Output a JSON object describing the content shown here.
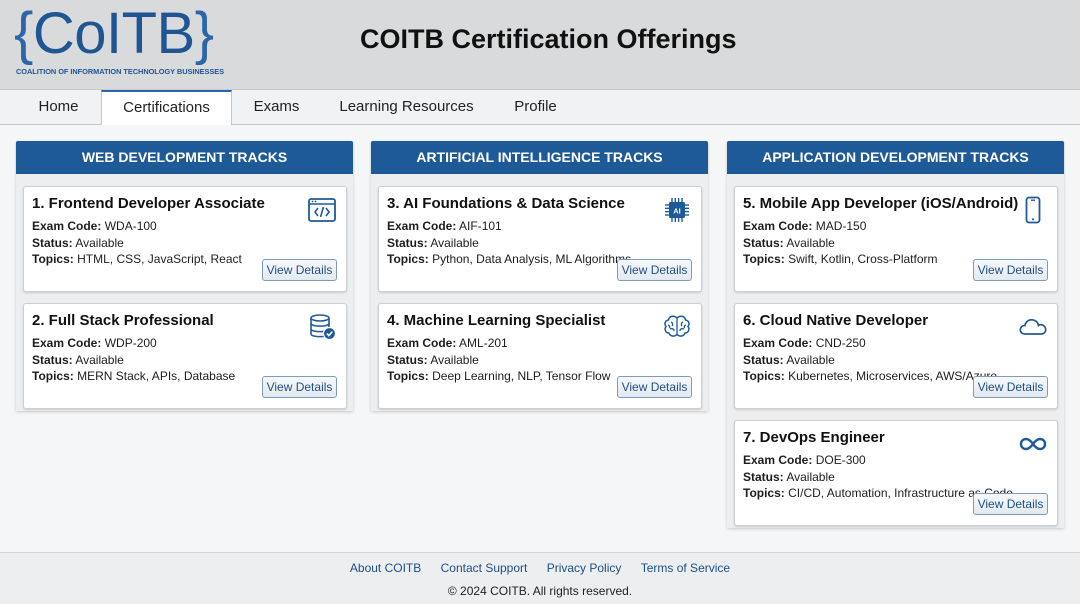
{
  "header": {
    "logo": {
      "open_brace": "{",
      "name": "CoITB",
      "close_brace": "}",
      "subtitle": "COALITION OF INFORMATION TECHNOLOGY BUSINESSES"
    },
    "title": "COITB Certification Offerings"
  },
  "nav": {
    "items": [
      {
        "label": "Home"
      },
      {
        "label": "Certifications",
        "active": true
      },
      {
        "label": "Exams"
      },
      {
        "label": "Learning Resources"
      },
      {
        "label": "Profile"
      }
    ]
  },
  "labels": {
    "exam_code": "Exam Code:",
    "status": "Status:",
    "topics": "Topics:",
    "view_details": "View Details"
  },
  "tracks": [
    {
      "title": "WEB DEVELOPMENT TRACKS",
      "certs": [
        {
          "title": "1. Frontend Developer Associate",
          "exam_code": "WDA-100",
          "status": "Available",
          "topics": "HTML, CSS, JavaScript, React",
          "icon": "code-window-icon"
        },
        {
          "title": "2. Full Stack Professional",
          "exam_code": "WDP-200",
          "status": "Available",
          "topics": "MERN Stack, APIs, Database",
          "icon": "database-check-icon"
        }
      ]
    },
    {
      "title": "ARTIFICIAL INTELLIGENCE TRACKS",
      "certs": [
        {
          "title": "3. AI Foundations & Data Science",
          "exam_code": "AIF-101",
          "status": "Available",
          "topics": "Python, Data Analysis, ML Algorithms",
          "icon": "ai-chip-icon",
          "icon_label": "AI"
        },
        {
          "title": "4. Machine Learning Specialist",
          "exam_code": "AML-201",
          "status": "Available",
          "topics": "Deep Learning, NLP, Tensor Flow",
          "icon": "brain-icon"
        }
      ]
    },
    {
      "title": "APPLICATION DEVELOPMENT TRACKS",
      "certs": [
        {
          "title": "5. Mobile App Developer (iOS/Android)",
          "exam_code": "MAD-150",
          "status": "Available",
          "topics": "Swift, Kotlin, Cross-Platform",
          "icon": "smartphone-icon"
        },
        {
          "title": "6. Cloud Native Developer",
          "exam_code": "CND-250",
          "status": "Available",
          "topics": "Kubernetes, Microservices, AWS/Azure",
          "icon": "cloud-icon"
        },
        {
          "title": "7. DevOps Engineer",
          "exam_code": "DOE-300",
          "status": "Available",
          "topics": "CI/CD, Automation, Infrastructure as Code",
          "icon": "infinity-icon"
        }
      ]
    }
  ],
  "footer": {
    "links": [
      "About COITB",
      "Contact Support",
      "Privacy Policy",
      "Terms of Service"
    ],
    "copyright": "© 2024 COITB. All rights reserved."
  },
  "colors": {
    "brand": "#1f5593",
    "track_header": "#1f5a98",
    "link": "#1e4f85",
    "topbar": "#d9dadb"
  }
}
